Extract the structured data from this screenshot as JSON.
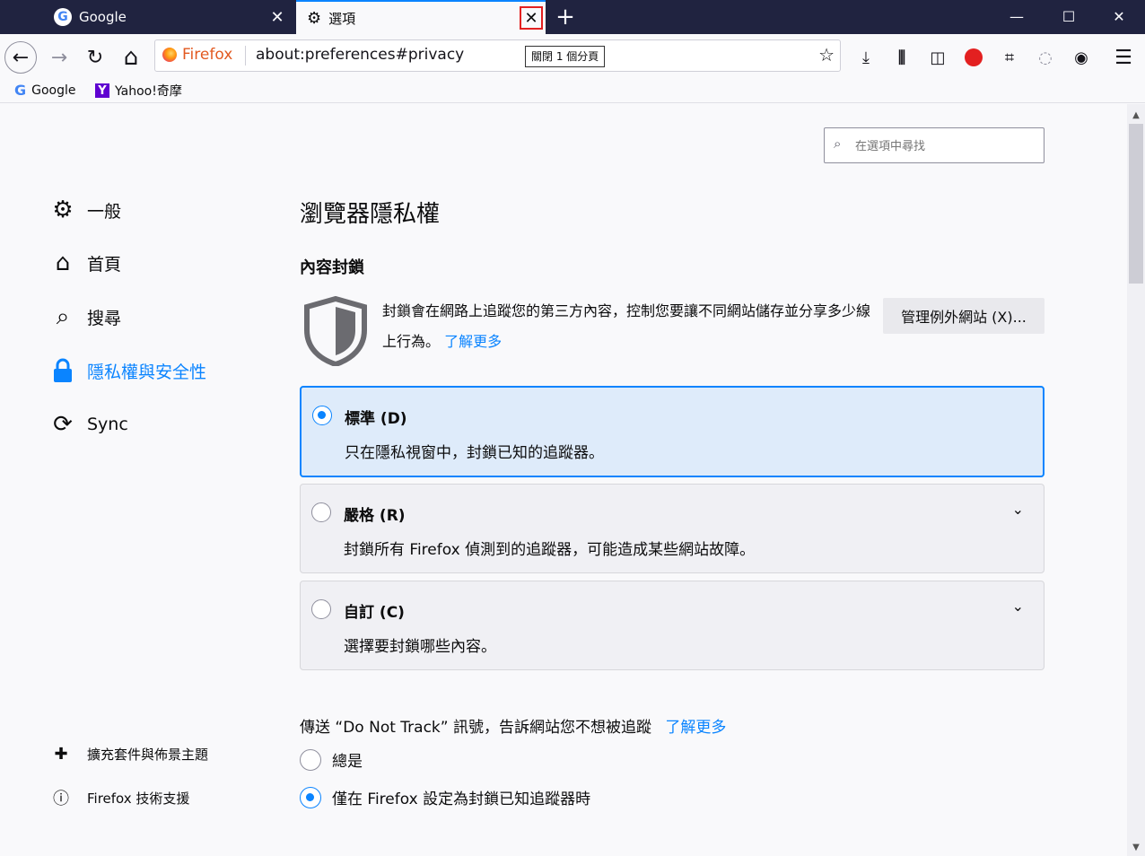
{
  "tabs": [
    {
      "title": "Google",
      "close": "✕"
    },
    {
      "title": "選項",
      "close": "✕"
    }
  ],
  "newtab_symbol": "+",
  "window_controls": {
    "minimize": "—",
    "maximize": "☐",
    "close": "✕"
  },
  "toolbar": {
    "back": "←",
    "forward": "→",
    "reload": "↻",
    "home": "⌂"
  },
  "urlbar": {
    "identity": "Firefox",
    "url": "about:preferences#privacy",
    "badge": "關閉 1 個分頁",
    "star": "☆"
  },
  "toolbar_icons": [
    "download-icon",
    "library-icon",
    "sidebar-icon",
    "adblock-icon",
    "crop-icon",
    "extension-icon",
    "account-icon",
    "menu-icon"
  ],
  "bookmarks": [
    {
      "icon": "G",
      "label": "Google"
    },
    {
      "icon": "Y",
      "label": "Yahoo!奇摩"
    }
  ],
  "search": {
    "placeholder": "在選項中尋找"
  },
  "sidebar": {
    "items": [
      {
        "label": "一般",
        "icon": "gear-icon"
      },
      {
        "label": "首頁",
        "icon": "home-icon"
      },
      {
        "label": "搜尋",
        "icon": "search-icon"
      },
      {
        "label": "隱私權與安全性",
        "icon": "lock-icon",
        "selected": true
      },
      {
        "label": "Sync",
        "icon": "sync-icon"
      }
    ],
    "footer": [
      {
        "label": "擴充套件與佈景主題",
        "icon": "puzzle-icon"
      },
      {
        "label": "Firefox 技術支援",
        "icon": "help-icon"
      }
    ]
  },
  "main": {
    "title": "瀏覽器隱私權",
    "section_title": "內容封鎖",
    "description": "封鎖會在網路上追蹤您的第三方內容，控制您要讓不同網站儲存並分享多少線上行為。",
    "learn_more": "了解更多",
    "manage_button": "管理例外網站 (X)...",
    "options": [
      {
        "label": "標準 (D)",
        "desc": "只在隱私視窗中，封鎖已知的追蹤器。",
        "selected": true
      },
      {
        "label": "嚴格 (R)",
        "desc": "封鎖所有 Firefox 偵測到的追蹤器，可能造成某些網站故障。",
        "selected": false
      },
      {
        "label": "自訂 (C)",
        "desc": "選擇要封鎖哪些內容。",
        "selected": false
      }
    ],
    "dnt": {
      "text": "傳送 “Do Not Track” 訊號，告訴網站您不想被追蹤",
      "learn_more": "了解更多",
      "options": [
        {
          "label": "總是",
          "selected": false
        },
        {
          "label": "僅在 Firefox 設定為封鎖已知追蹤器時",
          "selected": true
        }
      ]
    }
  },
  "colors": {
    "accent": "#0a84ff",
    "titlebar": "#202340",
    "selected_bg": "#deebfa"
  }
}
